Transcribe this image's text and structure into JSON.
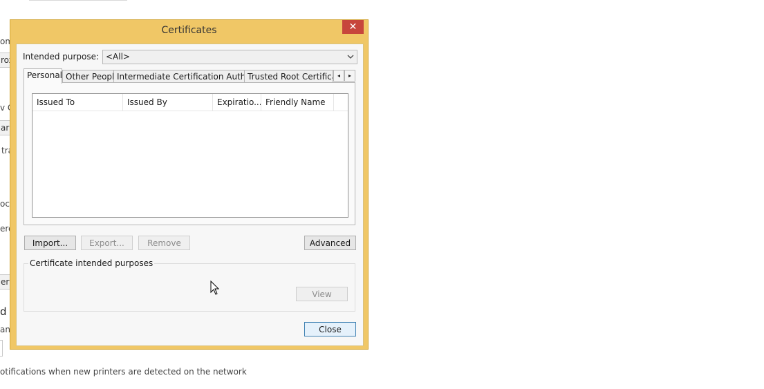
{
  "background": {
    "fragments": [
      "om",
      "rox",
      "v C",
      "ar",
      "tra",
      "oca",
      "ere",
      "ert",
      "d I",
      "ana"
    ],
    "footer_text": "otifications when new printers are detected on the network"
  },
  "dialog": {
    "title": "Certificates",
    "close_glyph": "✕",
    "intended_purpose_label": "Intended purpose:",
    "intended_purpose_value": "<All>",
    "tabs": [
      "Personal",
      "Other People",
      "Intermediate Certification Authorities",
      "Trusted Root Certification"
    ],
    "tab_scroll_left": "◂",
    "tab_scroll_right": "▸",
    "columns": [
      "Issued To",
      "Issued By",
      "Expiratio...",
      "Friendly Name"
    ],
    "buttons": {
      "import": "Import...",
      "export": "Export...",
      "remove": "Remove",
      "advanced": "Advanced",
      "view": "View",
      "close": "Close"
    },
    "purposes_group_label": "Certificate intended purposes"
  },
  "icons": {
    "dropdown": "chevron-down-icon",
    "cursor": "mouse-pointer-icon"
  }
}
